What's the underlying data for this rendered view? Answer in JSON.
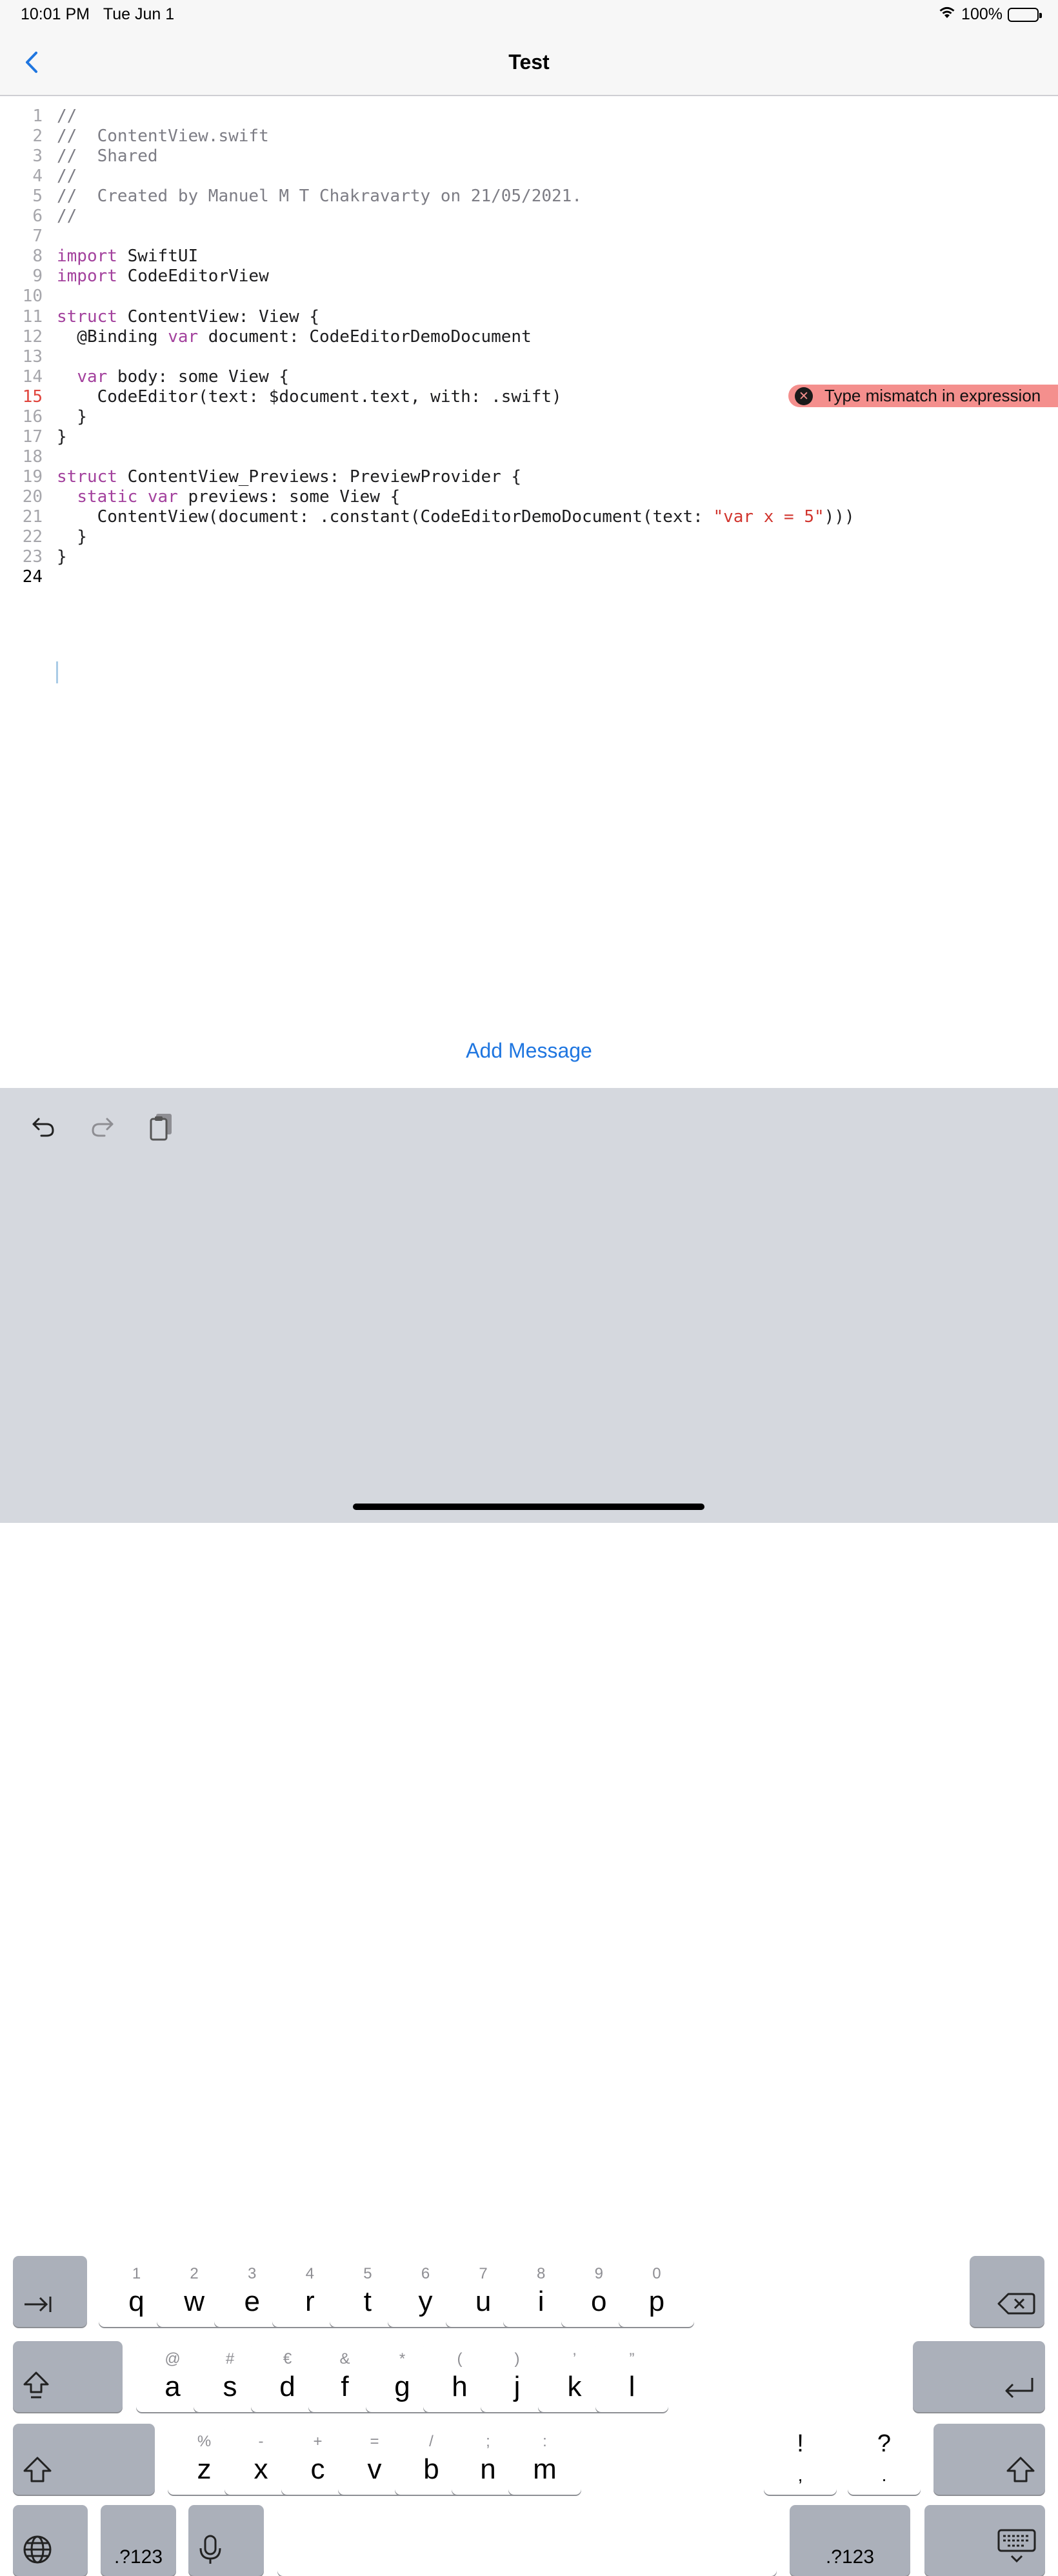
{
  "status_bar": {
    "time": "10:01 PM",
    "date": "Tue Jun 1",
    "battery": "100%"
  },
  "nav": {
    "title": "Test"
  },
  "editor": {
    "lines": [
      {
        "n": "1",
        "t": [
          [
            "c",
            "//"
          ]
        ]
      },
      {
        "n": "2",
        "t": [
          [
            "c",
            "//  ContentView.swift"
          ]
        ]
      },
      {
        "n": "3",
        "t": [
          [
            "c",
            "//  Shared"
          ]
        ]
      },
      {
        "n": "4",
        "t": [
          [
            "c",
            "//"
          ]
        ]
      },
      {
        "n": "5",
        "t": [
          [
            "c",
            "//  Created by Manuel M T Chakravarty on 21/05/2021."
          ]
        ]
      },
      {
        "n": "6",
        "t": [
          [
            "c",
            "//"
          ]
        ]
      },
      {
        "n": "7",
        "t": []
      },
      {
        "n": "8",
        "t": [
          [
            "k",
            "import"
          ],
          [
            "p",
            " SwiftUI"
          ]
        ]
      },
      {
        "n": "9",
        "t": [
          [
            "k",
            "import"
          ],
          [
            "p",
            " CodeEditorView"
          ]
        ]
      },
      {
        "n": "10",
        "t": []
      },
      {
        "n": "11",
        "t": [
          [
            "k",
            "struct"
          ],
          [
            "p",
            " ContentView: View {"
          ]
        ]
      },
      {
        "n": "12",
        "t": [
          [
            "p",
            "  @Binding "
          ],
          [
            "k",
            "var"
          ],
          [
            "p",
            " document: CodeEditorDemoDocument"
          ]
        ]
      },
      {
        "n": "13",
        "t": []
      },
      {
        "n": "14",
        "t": [
          [
            "p",
            "  "
          ],
          [
            "k",
            "var"
          ],
          [
            "p",
            " body: some View {"
          ]
        ]
      },
      {
        "n": "15",
        "t": [
          [
            "p",
            "    CodeEditor(text: $document.text, with: .swift)"
          ]
        ]
      },
      {
        "n": "16",
        "t": [
          [
            "p",
            "  }"
          ]
        ]
      },
      {
        "n": "17",
        "t": [
          [
            "p",
            "}"
          ]
        ]
      },
      {
        "n": "18",
        "t": []
      },
      {
        "n": "19",
        "t": [
          [
            "k",
            "struct"
          ],
          [
            "p",
            " ContentView_Previews: PreviewProvider {"
          ]
        ]
      },
      {
        "n": "20",
        "t": [
          [
            "p",
            "  "
          ],
          [
            "k",
            "static"
          ],
          [
            "p",
            " "
          ],
          [
            "k",
            "var"
          ],
          [
            "p",
            " previews: some View {"
          ]
        ]
      },
      {
        "n": "21",
        "t": [
          [
            "p",
            "    ContentView(document: .constant(CodeEditorDemoDocument(text: "
          ],
          [
            "s",
            "\"var x = 5\""
          ],
          [
            "p",
            ")))"
          ]
        ]
      },
      {
        "n": "22",
        "t": [
          [
            "p",
            "  }"
          ]
        ]
      },
      {
        "n": "23",
        "t": [
          [
            "p",
            "}"
          ]
        ]
      },
      {
        "n": "24",
        "t": []
      }
    ],
    "error_line": "15",
    "current_line": "24",
    "error_message": "Type mismatch in expression"
  },
  "add_message": "Add Message",
  "keyboard": {
    "row1": [
      {
        "alt": "1",
        "key": "q"
      },
      {
        "alt": "2",
        "key": "w"
      },
      {
        "alt": "3",
        "key": "e"
      },
      {
        "alt": "4",
        "key": "r"
      },
      {
        "alt": "5",
        "key": "t"
      },
      {
        "alt": "6",
        "key": "y"
      },
      {
        "alt": "7",
        "key": "u"
      },
      {
        "alt": "8",
        "key": "i"
      },
      {
        "alt": "9",
        "key": "o"
      },
      {
        "alt": "0",
        "key": "p"
      }
    ],
    "row2": [
      {
        "alt": "@",
        "key": "a"
      },
      {
        "alt": "#",
        "key": "s"
      },
      {
        "alt": "€",
        "key": "d"
      },
      {
        "alt": "&",
        "key": "f"
      },
      {
        "alt": "*",
        "key": "g"
      },
      {
        "alt": "(",
        "key": "h"
      },
      {
        "alt": ")",
        "key": "j"
      },
      {
        "alt": "’",
        "key": "k"
      },
      {
        "alt": "”",
        "key": "l"
      }
    ],
    "row3": [
      {
        "alt": "%",
        "key": "z"
      },
      {
        "alt": "-",
        "key": "x"
      },
      {
        "alt": "+",
        "key": "c"
      },
      {
        "alt": "=",
        "key": "v"
      },
      {
        "alt": "/",
        "key": "b"
      },
      {
        "alt": ";",
        "key": "n"
      },
      {
        "alt": ":",
        "key": "m"
      }
    ],
    "punct": [
      {
        "top": "!",
        "bottom": ","
      },
      {
        "top": "?",
        "bottom": "."
      }
    ],
    "numbers_label": ".?123",
    "icons": {
      "undo": "undo-icon",
      "redo": "redo-icon",
      "paste": "paste-icon",
      "tab": "tab-icon",
      "delete": "delete-icon",
      "shift": "shift-icon",
      "return": "return-icon",
      "globe": "globe-icon",
      "mic": "microphone-icon",
      "dismiss": "keyboard-dismiss-icon"
    }
  }
}
